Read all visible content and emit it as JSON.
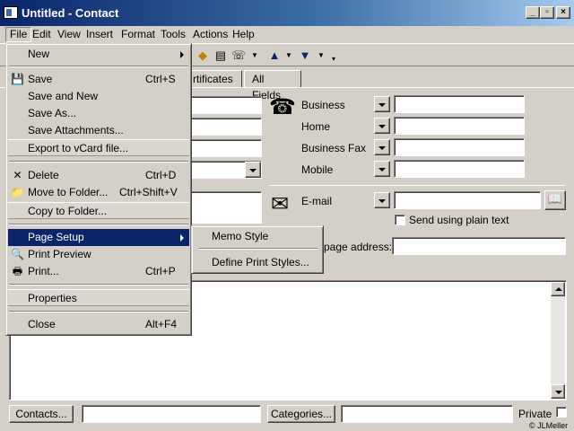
{
  "window": {
    "title": "Untitled - Contact"
  },
  "menubar": {
    "file": "File",
    "edit": "Edit",
    "view": "View",
    "insert": "Insert",
    "format": "Format",
    "tools": "Tools",
    "actions": "Actions",
    "help": "Help"
  },
  "tabs": {
    "certificates": "rtificates",
    "all_fields": "All Fields"
  },
  "phones": {
    "business": "Business",
    "home": "Home",
    "business_fax": "Business Fax",
    "mobile": "Mobile"
  },
  "email": {
    "label": "E-mail",
    "plain_text": "Send using plain text"
  },
  "web": {
    "label": "page address:"
  },
  "footer": {
    "contacts_button": "Contacts...",
    "categories_button": "Categories...",
    "private_label": "Private",
    "copyright": "© JLMeller"
  },
  "file_menu": {
    "new": "New",
    "save": "Save",
    "save_key": "Ctrl+S",
    "save_and_new": "Save and New",
    "save_as": "Save As...",
    "save_attachments": "Save Attachments...",
    "export_vcard": "Export to vCard file...",
    "delete": "Delete",
    "delete_key": "Ctrl+D",
    "move_to_folder": "Move to Folder...",
    "move_key": "Ctrl+Shift+V",
    "copy_to_folder": "Copy to Folder...",
    "page_setup": "Page Setup",
    "print_preview": "Print Preview",
    "print": "Print...",
    "print_key": "Ctrl+P",
    "properties": "Properties",
    "close": "Close",
    "close_key": "Alt+F4"
  },
  "page_setup_menu": {
    "memo_style": "Memo Style",
    "define_styles": "Define Print Styles..."
  },
  "colors": {
    "titlebar": "#0a246a",
    "highlight": "#0a246a",
    "face": "#d4d0c8"
  }
}
